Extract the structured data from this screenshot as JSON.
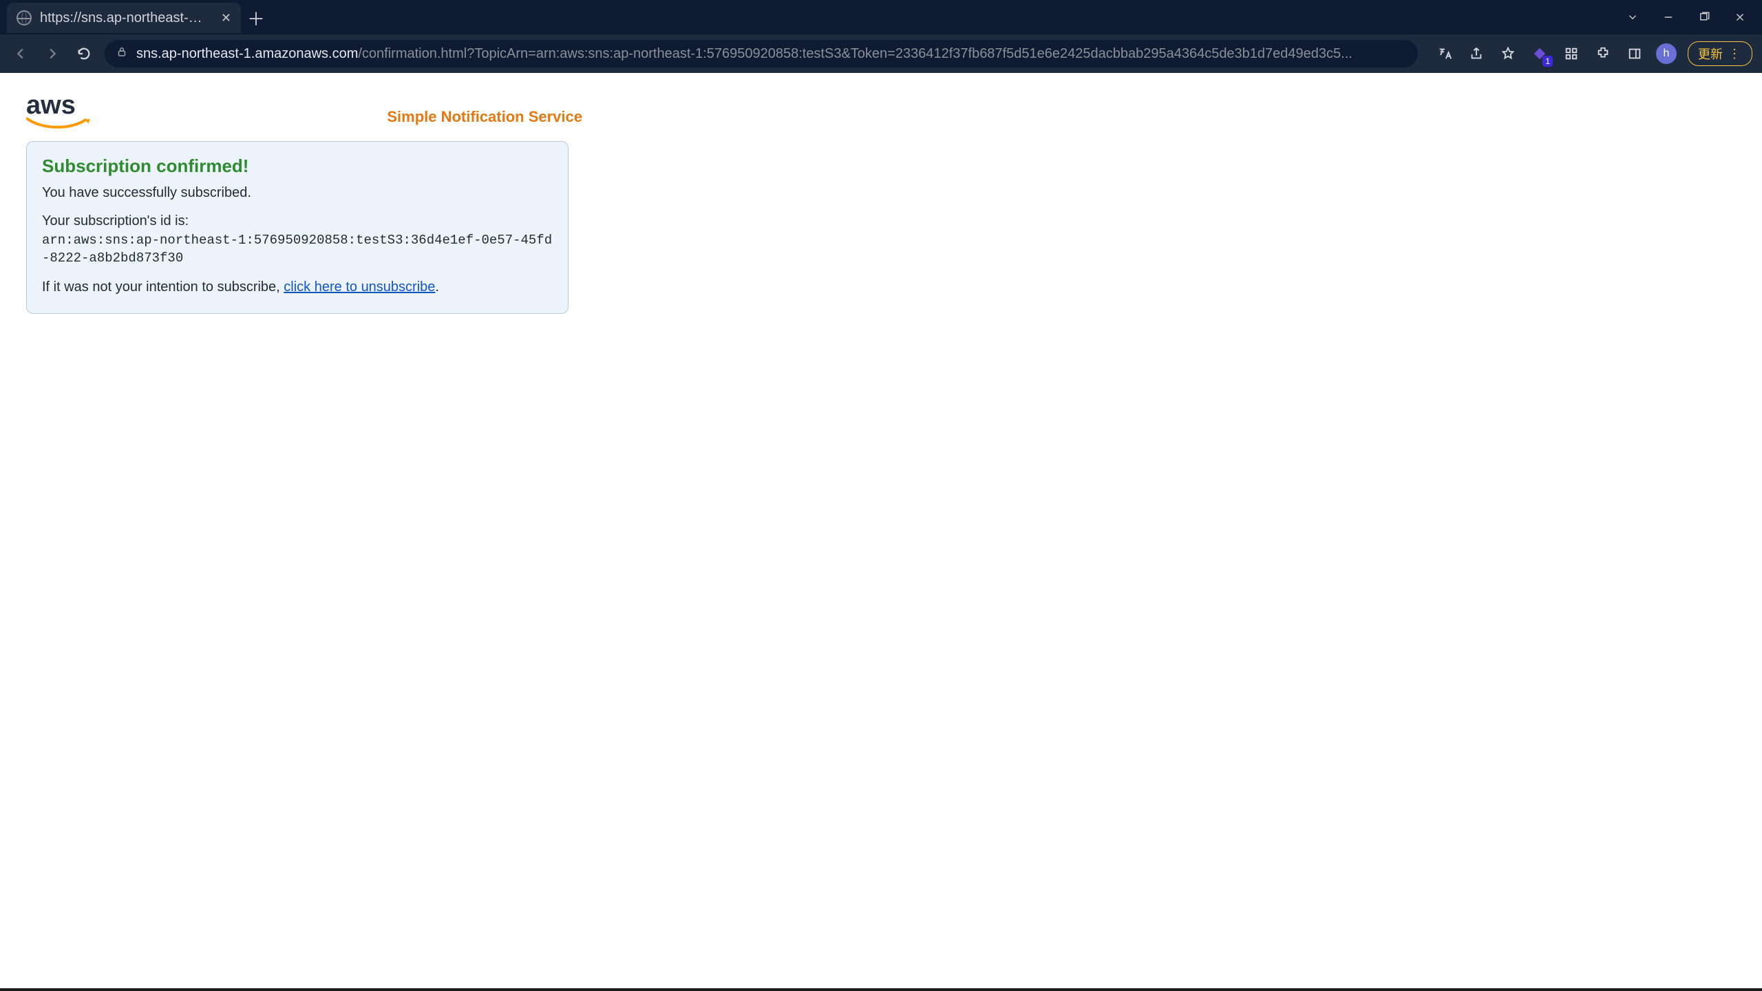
{
  "browser": {
    "tab_title": "https://sns.ap-northeast-1.amazo",
    "url_host": "sns.ap-northeast-1.amazonaws.com",
    "url_rest": "/confirmation.html?TopicArn=arn:aws:sns:ap-northeast-1:576950920858:testS3&Token=2336412f37fb687f5d51e6e2425dacbbab295a4364c5de3b1d7ed49ed3c5...",
    "update_label": "更新",
    "avatar_letter": "h",
    "extension_badge": "1"
  },
  "page": {
    "logo_text": "aws",
    "service_title": "Simple Notification Service",
    "heading": "Subscription confirmed!",
    "subscribed_msg": "You have successfully subscribed.",
    "id_label": "Your subscription's id is:",
    "subscription_id": "arn:aws:sns:ap-northeast-1:576950920858:testS3:36d4e1ef-0e57-45fd-8222-a8b2bd873f30",
    "unsubscribe_prefix": "If it was not your intention to subscribe, ",
    "unsubscribe_link": "click here to unsubscribe",
    "unsubscribe_suffix": "."
  }
}
